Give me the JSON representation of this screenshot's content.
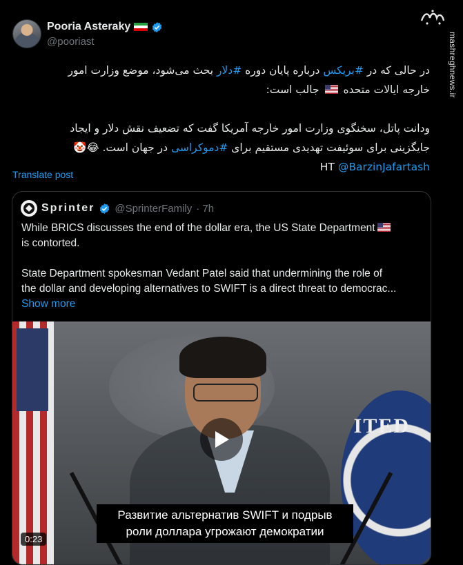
{
  "author": {
    "name": "Pooria Asteraky",
    "handle": "@pooriast",
    "flag_emoji": "🇮🇷",
    "verified": true
  },
  "watermark": {
    "brand_logo_text": "مشرق",
    "site": "mashreghnews.ir"
  },
  "post": {
    "line1_prefix": "در حالی که در ",
    "tag_brics": "#بریکس",
    "line1_mid": " درباره پایان دوره ",
    "tag_dollar": "#دلار",
    "line1_suffix": " بحث می‌شود، موضع وزارت امور",
    "line2_prefix": "خارجه ایالات متحده ",
    "line2_suffix": " جالب است:",
    "line3": "ودانت پاتل، سخنگوی وزارت امور خارجه آمریکا گفت که تضعیف نقش دلار و ایجاد",
    "line4_prefix": "جایگزینی برای سوئیفت تهدیدی مستقیم برای ",
    "tag_democracy": "#دموکراسی",
    "line4_suffix": " در جهان است. 😂🤡",
    "ht_label": "HT ",
    "ht_mention": "@BarzinJafartash"
  },
  "translate_label": "Translate post",
  "quote": {
    "name": "Sprinter",
    "handle": "@SprinterFamily",
    "time": "· 7h",
    "line1": "While BRICS discusses the end of the dollar era, the US State Department",
    "line2": "is contorted.",
    "line3": "State Department spokesman Vedant Patel said that undermining the role of",
    "line4": "the dollar and developing alternatives to SWIFT is a direct threat to democrac...",
    "show_more": "Show more"
  },
  "video": {
    "subtitle_line1": "Развитие альтернатив SWIFT и подрыв",
    "subtitle_line2": "роли доллара угрожают демократии",
    "duration": "0:23",
    "seal_text": "ITED"
  },
  "colors": {
    "background": "#000000",
    "text": "#e7e9ea",
    "muted": "#71767b",
    "link": "#1d9bf0",
    "border": "#2f3336"
  }
}
